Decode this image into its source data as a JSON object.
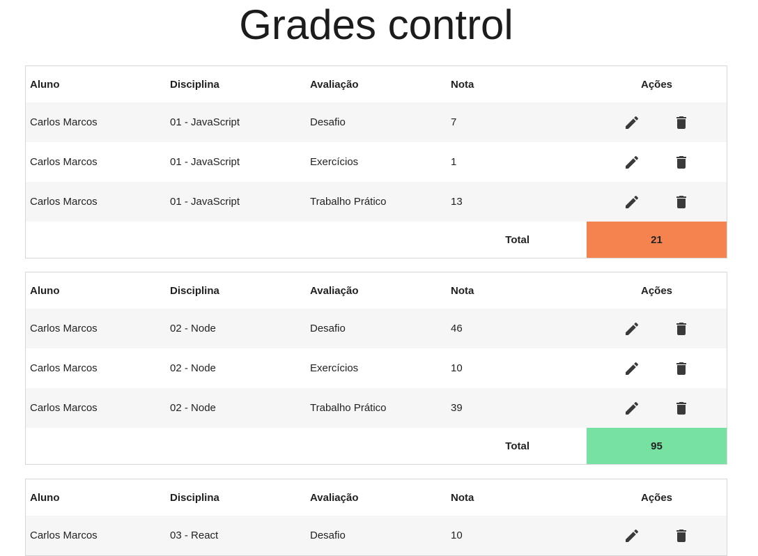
{
  "page": {
    "title": "Grades control"
  },
  "headers": {
    "student": "Aluno",
    "subject": "Disciplina",
    "evaluation": "Avaliação",
    "grade": "Nota",
    "actions": "Ações"
  },
  "total_label": "Total",
  "icons": {
    "edit": "pencil-icon",
    "delete": "trash-icon"
  },
  "colors": {
    "total_low": "#f5834f",
    "total_high": "#76e1a1"
  },
  "tables": [
    {
      "rows": [
        {
          "student": "Carlos Marcos",
          "subject": "01 - JavaScript",
          "evaluation": "Desafio",
          "grade": "7"
        },
        {
          "student": "Carlos Marcos",
          "subject": "01 - JavaScript",
          "evaluation": "Exercícios",
          "grade": "1"
        },
        {
          "student": "Carlos Marcos",
          "subject": "01 - JavaScript",
          "evaluation": "Trabalho Prático",
          "grade": "13"
        }
      ],
      "total": "21",
      "total_color": "#f5834f"
    },
    {
      "rows": [
        {
          "student": "Carlos Marcos",
          "subject": "02 - Node",
          "evaluation": "Desafio",
          "grade": "46"
        },
        {
          "student": "Carlos Marcos",
          "subject": "02 - Node",
          "evaluation": "Exercícios",
          "grade": "10"
        },
        {
          "student": "Carlos Marcos",
          "subject": "02 - Node",
          "evaluation": "Trabalho Prático",
          "grade": "39"
        }
      ],
      "total": "95",
      "total_color": "#76e1a1"
    },
    {
      "rows": [
        {
          "student": "Carlos Marcos",
          "subject": "03 - React",
          "evaluation": "Desafio",
          "grade": "10"
        }
      ],
      "total": null,
      "total_color": null
    }
  ]
}
